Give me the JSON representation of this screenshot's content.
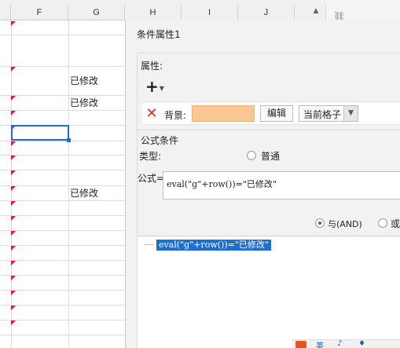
{
  "spreadsheet": {
    "columns": [
      "F",
      "G",
      "H",
      "I",
      "J"
    ],
    "cell_values": [
      "已修改",
      "已修改",
      "已修改"
    ]
  },
  "dialog": {
    "title": "条件属性1",
    "properties_label": "属性:",
    "background_label": "背景:",
    "background_color": "#fbc794",
    "edit_label": "编辑",
    "scope_value": "当前格子",
    "formula_section_label": "公式条件",
    "type_label": "类型:",
    "type_option_normal": "普通",
    "formula_label": "公式=",
    "formula_value": "eval(\"g\"+row())=\"已修改\"",
    "logic_and_label": "与(AND)",
    "logic_or_label": "或",
    "condition_item": "eval(\"g\"+row())=\"已修改\""
  },
  "ime": {
    "glyphs": [
      "英",
      "♪",
      "♦"
    ]
  },
  "colors": {
    "accent": "#1f6fd1",
    "delete_red": "#e0281b",
    "flag_red": "#e8173a"
  }
}
